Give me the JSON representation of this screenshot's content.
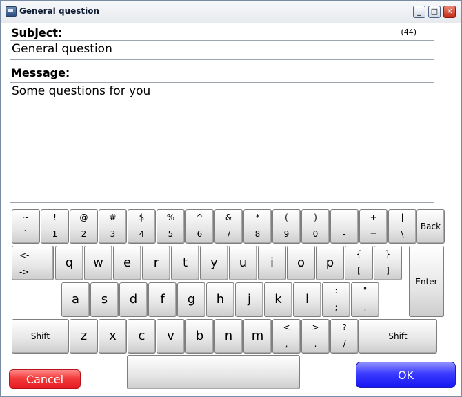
{
  "window": {
    "title": "General question",
    "controls": {
      "minimize": "_",
      "maximize": "□",
      "close": "✕"
    }
  },
  "form": {
    "subject_label": "Subject:",
    "subject_counter": "(44)",
    "subject_value": "General question",
    "message_label": "Message:",
    "message_value": "Some questions for you"
  },
  "keyboard": {
    "row1": [
      {
        "top": "~",
        "bottom": "`"
      },
      {
        "top": "!",
        "bottom": "1"
      },
      {
        "top": "@",
        "bottom": "2"
      },
      {
        "top": "#",
        "bottom": "3"
      },
      {
        "top": "$",
        "bottom": "4"
      },
      {
        "top": "%",
        "bottom": "5"
      },
      {
        "top": "^",
        "bottom": "6"
      },
      {
        "top": "&",
        "bottom": "7"
      },
      {
        "top": "*",
        "bottom": "8"
      },
      {
        "top": "(",
        "bottom": "9"
      },
      {
        "top": ")",
        "bottom": "0"
      },
      {
        "top": "_",
        "bottom": "-"
      },
      {
        "top": "+",
        "bottom": "="
      },
      {
        "top": "|",
        "bottom": "\\"
      }
    ],
    "back": "Back",
    "tab": {
      "top": "<-",
      "bottom": "->"
    },
    "row2": [
      "q",
      "w",
      "e",
      "r",
      "t",
      "y",
      "u",
      "i",
      "o",
      "p"
    ],
    "row2_sym": [
      {
        "top": "{",
        "bottom": "["
      },
      {
        "top": "}",
        "bottom": "]"
      }
    ],
    "enter": "Enter",
    "row3": [
      "a",
      "s",
      "d",
      "f",
      "g",
      "h",
      "j",
      "k",
      "l"
    ],
    "row3_sym": [
      {
        "top": ":",
        "bottom": ";"
      },
      {
        "top": "\"",
        "bottom": ","
      }
    ],
    "shift": "Shift",
    "row4": [
      "z",
      "x",
      "c",
      "v",
      "b",
      "n",
      "m"
    ],
    "row4_sym": [
      {
        "top": "<",
        "bottom": ","
      },
      {
        "top": ">",
        "bottom": "."
      },
      {
        "top": "?",
        "bottom": "/"
      }
    ],
    "space": ""
  },
  "actions": {
    "cancel": "Cancel",
    "ok": "OK"
  }
}
